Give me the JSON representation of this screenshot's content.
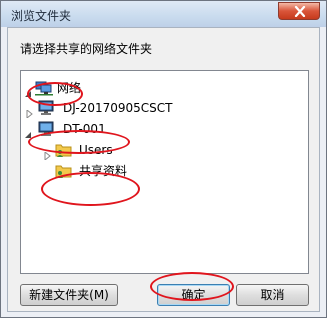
{
  "window": {
    "title": "浏览文件夹"
  },
  "dialog": {
    "prompt": "请选择共享的网络文件夹"
  },
  "tree": {
    "network": {
      "label": "网络",
      "icon": "network-icon"
    },
    "computer1": {
      "label": "DJ-20170905CSCT",
      "icon": "computer-icon"
    },
    "computer2": {
      "label": "DT-001",
      "icon": "computer-icon"
    },
    "users": {
      "label": "Users",
      "icon": "shared-folder-icon"
    },
    "shared": {
      "label": "共享资料",
      "icon": "shared-folder-icon"
    }
  },
  "buttons": {
    "new_folder": "新建文件夹(M)",
    "ok": "确定",
    "cancel": "取消"
  },
  "colors": {
    "annotation": "#e0151d",
    "close_button": "#c63a1c"
  }
}
